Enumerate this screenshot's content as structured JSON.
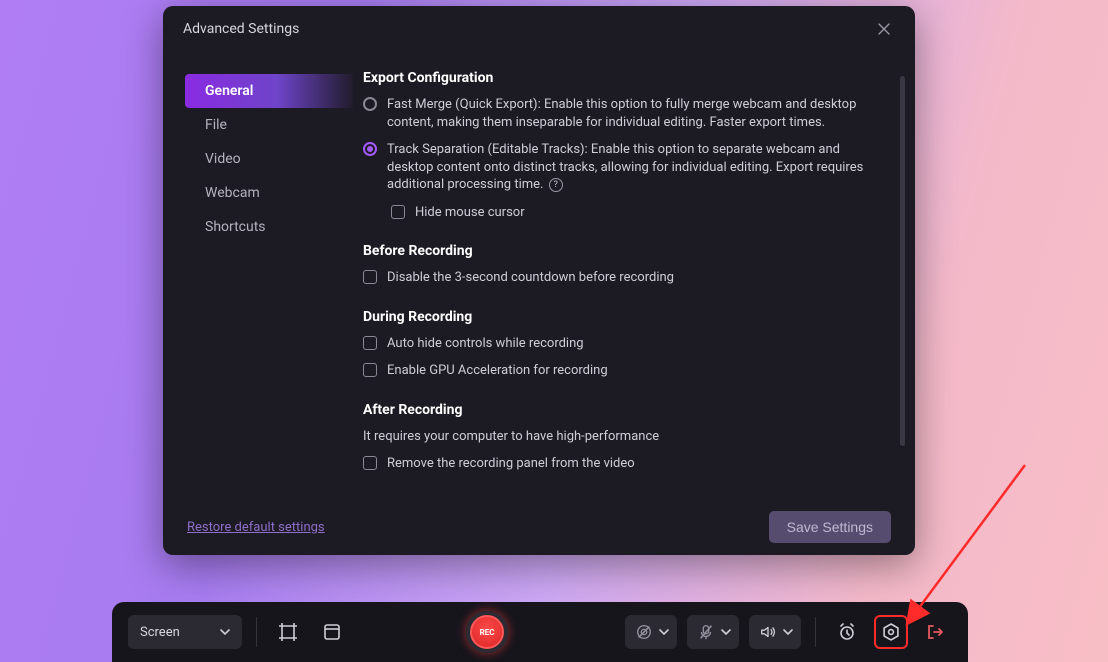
{
  "modal": {
    "title": "Advanced Settings",
    "sidebar": {
      "items": [
        {
          "label": "General",
          "active": true
        },
        {
          "label": "File"
        },
        {
          "label": "Video"
        },
        {
          "label": "Webcam"
        },
        {
          "label": "Shortcuts"
        }
      ]
    },
    "sections": {
      "export": {
        "title": "Export Configuration",
        "fast_merge": "Fast Merge (Quick Export): Enable this option to fully merge webcam and desktop content, making them inseparable for individual editing. Faster export times.",
        "track_separation": "Track Separation (Editable Tracks): Enable this option to separate webcam and desktop content onto distinct tracks, allowing for individual editing. Export requires additional processing time.",
        "hide_cursor": "Hide mouse cursor"
      },
      "before": {
        "title": "Before Recording",
        "disable_countdown": "Disable the 3-second countdown before recording"
      },
      "during": {
        "title": "During Recording",
        "auto_hide": "Auto hide controls while recording",
        "gpu": "Enable GPU Acceleration for recording"
      },
      "after": {
        "title": "After Recording",
        "note": "It requires your computer to have high-performance",
        "remove_panel": "Remove the recording panel from the video"
      }
    },
    "footer": {
      "restore": "Restore default settings",
      "save": "Save Settings"
    }
  },
  "toolbar": {
    "mode_label": "Screen",
    "rec_label": "REC"
  }
}
